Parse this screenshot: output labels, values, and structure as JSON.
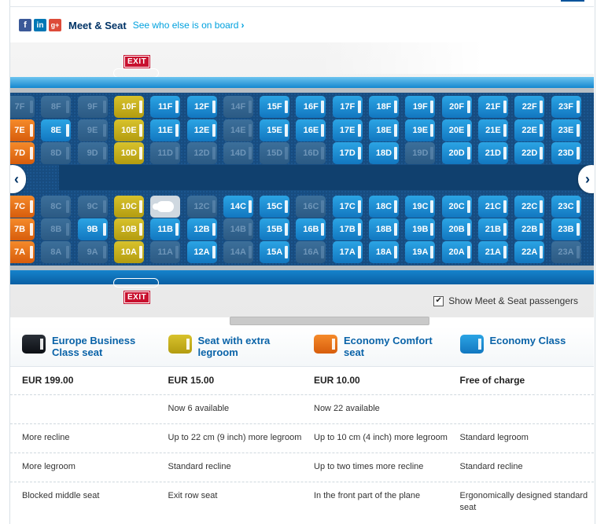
{
  "header": {
    "social": [
      {
        "icon": "facebook-icon",
        "glyph": "f"
      },
      {
        "icon": "linkedin-icon",
        "glyph": "in"
      },
      {
        "icon": "googleplus-icon",
        "glyph": "g+"
      }
    ],
    "title": "Meet & Seat",
    "link": "See who else is on board",
    "link_chevron": "›"
  },
  "map": {
    "exit_top": "EXIT",
    "exit_bottom": "EXIT",
    "nav_left": "‹",
    "nav_right": "›",
    "show_passengers": "Show Meet & Seat passengers",
    "show_passengers_checked": "✔",
    "rows": [
      {
        "row": 7,
        "seats": {
          "F": "occupied",
          "E": "comfort",
          "D": "comfort",
          "C": "comfort",
          "B": "comfort",
          "A": "comfort"
        }
      },
      {
        "row": 8,
        "seats": {
          "F": "occupied",
          "E": "economy",
          "D": "occupied",
          "C": "occupied",
          "B": "occupied",
          "A": "occupied"
        }
      },
      {
        "row": 9,
        "seats": {
          "F": "occupied",
          "E": "occupied",
          "D": "occupied",
          "C": "occupied",
          "B": "economy",
          "A": "occupied"
        }
      },
      {
        "row": 10,
        "seats": {
          "F": "legroom",
          "E": "legroom",
          "D": "legroom",
          "C": "legroom",
          "B": "legroom",
          "A": "legroom"
        }
      },
      {
        "row": 11,
        "seats": {
          "F": "economy",
          "E": "economy",
          "D": "occupied",
          "C": "avatar",
          "B": "economy",
          "A": "occupied"
        }
      },
      {
        "row": 12,
        "seats": {
          "F": "economy",
          "E": "economy",
          "D": "occupied",
          "C": "occupied",
          "B": "economy",
          "A": "economy"
        }
      },
      {
        "row": 14,
        "seats": {
          "F": "occupied",
          "E": "occupied",
          "D": "occupied",
          "C": "economy",
          "B": "occupied",
          "A": "occupied"
        }
      },
      {
        "row": 15,
        "seats": {
          "F": "economy",
          "E": "economy",
          "D": "occupied",
          "C": "economy",
          "B": "economy",
          "A": "economy"
        }
      },
      {
        "row": 16,
        "seats": {
          "F": "economy",
          "E": "economy",
          "D": "occupied",
          "C": "occupied",
          "B": "economy",
          "A": "occupied"
        }
      },
      {
        "row": 17,
        "seats": {
          "F": "economy",
          "E": "economy",
          "D": "economy",
          "C": "economy",
          "B": "economy",
          "A": "economy"
        }
      },
      {
        "row": 18,
        "seats": {
          "F": "economy",
          "E": "economy",
          "D": "economy",
          "C": "economy",
          "B": "economy",
          "A": "economy"
        }
      },
      {
        "row": 19,
        "seats": {
          "F": "economy",
          "E": "economy",
          "D": "occupied",
          "C": "economy",
          "B": "economy",
          "A": "economy"
        }
      },
      {
        "row": 20,
        "seats": {
          "F": "economy",
          "E": "economy",
          "D": "economy",
          "C": "economy",
          "B": "economy",
          "A": "economy"
        }
      },
      {
        "row": 21,
        "seats": {
          "F": "economy",
          "E": "economy",
          "D": "economy",
          "C": "economy",
          "B": "economy",
          "A": "economy"
        }
      },
      {
        "row": 22,
        "seats": {
          "F": "economy",
          "E": "economy",
          "D": "economy",
          "C": "economy",
          "B": "economy",
          "A": "economy"
        }
      },
      {
        "row": 23,
        "seats": {
          "F": "economy",
          "E": "economy",
          "D": "economy",
          "C": "economy",
          "B": "economy",
          "A": "occupied"
        }
      }
    ]
  },
  "legend": [
    {
      "swatch": "business",
      "name": "Europe Business Class seat",
      "price": "EUR 199.00",
      "availability": "",
      "f1": "More recline",
      "f2": "More legroom",
      "f3": "Blocked middle seat"
    },
    {
      "swatch": "legroom",
      "name": "Seat with extra legroom",
      "price": "EUR 15.00",
      "availability": "Now 6 available",
      "f1": "Up to 22 cm (9 inch) more legroom",
      "f2": "Standard recline",
      "f3": "Exit row seat"
    },
    {
      "swatch": "comfort",
      "name": "Economy Comfort seat",
      "price": "EUR 10.00",
      "availability": "Now 22 available",
      "f1": "Up to 10 cm (4 inch) more legroom",
      "f2": "Up to two times more recline",
      "f3": "In the front part of the plane"
    },
    {
      "swatch": "economy",
      "name": "Economy Class",
      "price": "Free of charge",
      "availability": "",
      "f1": "Standard legroom",
      "f2": "Standard recline",
      "f3": "Ergonomically designed standard seat"
    }
  ]
}
